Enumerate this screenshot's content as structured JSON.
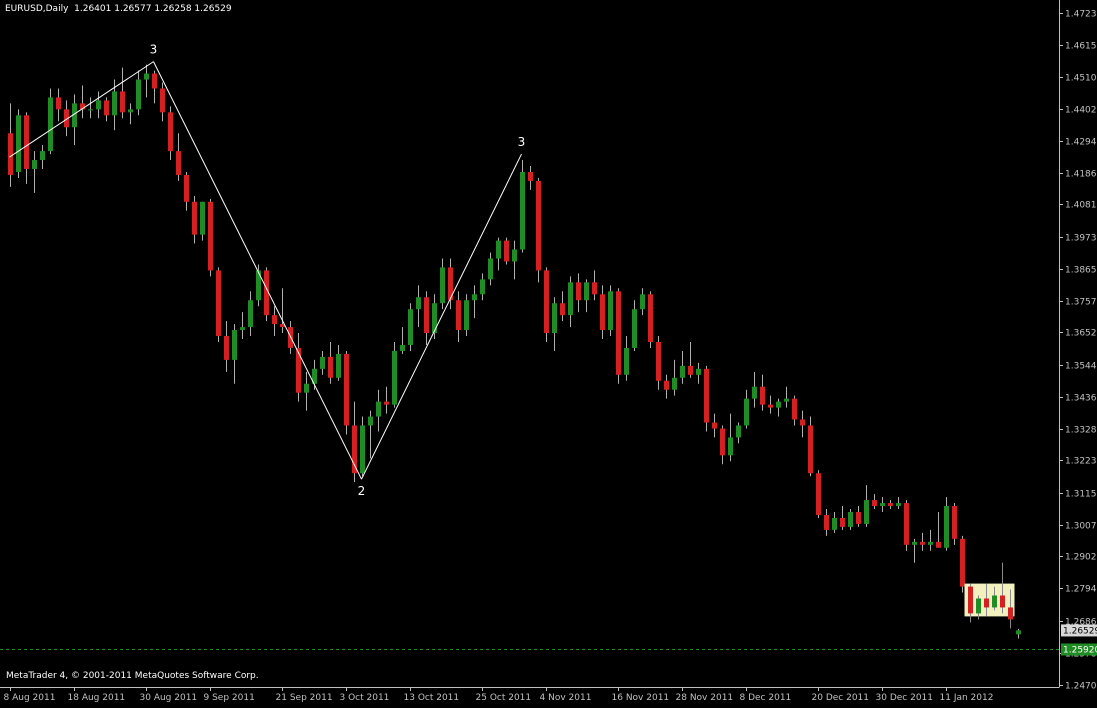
{
  "header": {
    "symbol": "EURUSD,Daily",
    "open": "1.26401",
    "high": "1.26577",
    "low": "1.26258",
    "close": "1.26529"
  },
  "copyright": "MetaTrader 4, © 2001-2011 MetaQuotes Software Corp.",
  "colors": {
    "background": "#000000",
    "axis": "#c0c0c0",
    "bull": "#1f8c24",
    "bear": "#d42020",
    "wick": "#b0b0b0",
    "zigzag": "#ffffff",
    "highlight": "#f3f0c0",
    "ask_line": "#1f8c24",
    "price_label_bg": "#1f8c24",
    "current_price_bg": "#d8d8d8"
  },
  "chart_data": {
    "type": "candlestick",
    "symbol": "EURUSD",
    "timeframe": "Daily",
    "y_ticks": [
      "1.47230",
      "1.46150",
      "1.45100",
      "1.44020",
      "1.42940",
      "1.41860",
      "1.40810",
      "1.39730",
      "1.38650",
      "1.37570",
      "1.36520",
      "1.35440",
      "1.34360",
      "1.33280",
      "1.32230",
      "1.31150",
      "1.30070",
      "1.29020",
      "1.27940",
      "1.26860",
      "1.25780",
      "1.24700"
    ],
    "x_tick_labels": [
      "8 Aug 2011",
      "18 Aug 2011",
      "30 Aug 2011",
      "9 Sep 2011",
      "21 Sep 2011",
      "3 Oct 2011",
      "13 Oct 2011",
      "25 Oct 2011",
      "4 Nov 2011",
      "16 Nov 2011",
      "28 Nov 2011",
      "8 Dec 2011",
      "20 Dec 2011",
      "30 Dec 2011",
      "11 Jan 2012"
    ],
    "x_tick_index": [
      0,
      8,
      17,
      25,
      34,
      42,
      50,
      59,
      67,
      76,
      84,
      92,
      101,
      109,
      117
    ],
    "ylim": [
      1.247,
      1.4723
    ],
    "current_price": "1.26529",
    "ask_price": "1.25920",
    "ask_level": 1.2592,
    "candles": [
      [
        1.432,
        1.442,
        1.414,
        1.418
      ],
      [
        1.419,
        1.44,
        1.417,
        1.438
      ],
      [
        1.438,
        1.439,
        1.415,
        1.42
      ],
      [
        1.42,
        1.426,
        1.412,
        1.423
      ],
      [
        1.423,
        1.428,
        1.42,
        1.426
      ],
      [
        1.426,
        1.447,
        1.425,
        1.444
      ],
      [
        1.444,
        1.447,
        1.436,
        1.44
      ],
      [
        1.44,
        1.443,
        1.431,
        1.434
      ],
      [
        1.434,
        1.445,
        1.428,
        1.442
      ],
      [
        1.442,
        1.448,
        1.437,
        1.44
      ],
      [
        1.44,
        1.444,
        1.437,
        1.44
      ],
      [
        1.44,
        1.446,
        1.437,
        1.443
      ],
      [
        1.443,
        1.444,
        1.436,
        1.438
      ],
      [
        1.438,
        1.45,
        1.433,
        1.446
      ],
      [
        1.446,
        1.454,
        1.437,
        1.439
      ],
      [
        1.439,
        1.442,
        1.435,
        1.44
      ],
      [
        1.44,
        1.453,
        1.438,
        1.45
      ],
      [
        1.45,
        1.455,
        1.444,
        1.452
      ],
      [
        1.452,
        1.453,
        1.442,
        1.447
      ],
      [
        1.447,
        1.449,
        1.436,
        1.439
      ],
      [
        1.439,
        1.441,
        1.423,
        1.426
      ],
      [
        1.426,
        1.432,
        1.416,
        1.418
      ],
      [
        1.418,
        1.419,
        1.406,
        1.409
      ],
      [
        1.409,
        1.411,
        1.395,
        1.398
      ],
      [
        1.398,
        1.409,
        1.396,
        1.409
      ],
      [
        1.409,
        1.41,
        1.384,
        1.386
      ],
      [
        1.386,
        1.387,
        1.362,
        1.364
      ],
      [
        1.364,
        1.369,
        1.352,
        1.356
      ],
      [
        1.356,
        1.368,
        1.348,
        1.366
      ],
      [
        1.366,
        1.372,
        1.363,
        1.367
      ],
      [
        1.367,
        1.379,
        1.364,
        1.376
      ],
      [
        1.376,
        1.388,
        1.374,
        1.386
      ],
      [
        1.386,
        1.387,
        1.369,
        1.371
      ],
      [
        1.371,
        1.374,
        1.364,
        1.368
      ],
      [
        1.368,
        1.38,
        1.365,
        1.367
      ],
      [
        1.367,
        1.369,
        1.358,
        1.36
      ],
      [
        1.36,
        1.365,
        1.342,
        1.345
      ],
      [
        1.345,
        1.352,
        1.339,
        1.348
      ],
      [
        1.348,
        1.356,
        1.346,
        1.353
      ],
      [
        1.353,
        1.359,
        1.351,
        1.357
      ],
      [
        1.357,
        1.362,
        1.348,
        1.35
      ],
      [
        1.35,
        1.361,
        1.349,
        1.358
      ],
      [
        1.358,
        1.359,
        1.331,
        1.334
      ],
      [
        1.334,
        1.342,
        1.315,
        1.318
      ],
      [
        1.318,
        1.337,
        1.317,
        1.334
      ],
      [
        1.334,
        1.339,
        1.323,
        1.337
      ],
      [
        1.337,
        1.346,
        1.332,
        1.342
      ],
      [
        1.342,
        1.347,
        1.338,
        1.341
      ],
      [
        1.341,
        1.362,
        1.34,
        1.359
      ],
      [
        1.359,
        1.367,
        1.358,
        1.361
      ],
      [
        1.361,
        1.375,
        1.359,
        1.373
      ],
      [
        1.373,
        1.381,
        1.367,
        1.377
      ],
      [
        1.377,
        1.379,
        1.361,
        1.365
      ],
      [
        1.365,
        1.378,
        1.363,
        1.375
      ],
      [
        1.375,
        1.39,
        1.373,
        1.387
      ],
      [
        1.387,
        1.39,
        1.373,
        1.376
      ],
      [
        1.376,
        1.379,
        1.362,
        1.366
      ],
      [
        1.366,
        1.378,
        1.364,
        1.376
      ],
      [
        1.376,
        1.381,
        1.37,
        1.378
      ],
      [
        1.378,
        1.385,
        1.376,
        1.383
      ],
      [
        1.383,
        1.392,
        1.381,
        1.39
      ],
      [
        1.39,
        1.397,
        1.386,
        1.396
      ],
      [
        1.396,
        1.397,
        1.388,
        1.389
      ],
      [
        1.389,
        1.396,
        1.383,
        1.393
      ],
      [
        1.393,
        1.423,
        1.392,
        1.419
      ],
      [
        1.419,
        1.421,
        1.413,
        1.416
      ],
      [
        1.416,
        1.417,
        1.382,
        1.386
      ],
      [
        1.386,
        1.387,
        1.362,
        1.365
      ],
      [
        1.365,
        1.377,
        1.359,
        1.375
      ],
      [
        1.375,
        1.379,
        1.369,
        1.371
      ],
      [
        1.371,
        1.384,
        1.367,
        1.382
      ],
      [
        1.382,
        1.385,
        1.372,
        1.376
      ],
      [
        1.376,
        1.383,
        1.372,
        1.382
      ],
      [
        1.382,
        1.386,
        1.376,
        1.378
      ],
      [
        1.378,
        1.381,
        1.363,
        1.366
      ],
      [
        1.366,
        1.381,
        1.364,
        1.379
      ],
      [
        1.379,
        1.38,
        1.348,
        1.351
      ],
      [
        1.351,
        1.364,
        1.349,
        1.36
      ],
      [
        1.36,
        1.376,
        1.359,
        1.373
      ],
      [
        1.373,
        1.38,
        1.371,
        1.378
      ],
      [
        1.378,
        1.379,
        1.36,
        1.362
      ],
      [
        1.362,
        1.364,
        1.346,
        1.349
      ],
      [
        1.349,
        1.351,
        1.343,
        1.346
      ],
      [
        1.346,
        1.356,
        1.344,
        1.35
      ],
      [
        1.35,
        1.359,
        1.348,
        1.354
      ],
      [
        1.354,
        1.362,
        1.35,
        1.351
      ],
      [
        1.351,
        1.355,
        1.348,
        1.353
      ],
      [
        1.353,
        1.354,
        1.332,
        1.335
      ],
      [
        1.335,
        1.338,
        1.33,
        1.333
      ],
      [
        1.333,
        1.334,
        1.321,
        1.324
      ],
      [
        1.324,
        1.338,
        1.322,
        1.33
      ],
      [
        1.33,
        1.335,
        1.328,
        1.334
      ],
      [
        1.334,
        1.346,
        1.333,
        1.343
      ],
      [
        1.343,
        1.352,
        1.34,
        1.347
      ],
      [
        1.347,
        1.351,
        1.339,
        1.341
      ],
      [
        1.341,
        1.344,
        1.338,
        1.34
      ],
      [
        1.34,
        1.343,
        1.337,
        1.342
      ],
      [
        1.342,
        1.347,
        1.34,
        1.343
      ],
      [
        1.343,
        1.344,
        1.334,
        1.336
      ],
      [
        1.336,
        1.339,
        1.33,
        1.334
      ],
      [
        1.334,
        1.337,
        1.317,
        1.318
      ],
      [
        1.318,
        1.319,
        1.303,
        1.304
      ],
      [
        1.304,
        1.306,
        1.297,
        1.299
      ],
      [
        1.299,
        1.305,
        1.298,
        1.303
      ],
      [
        1.303,
        1.307,
        1.299,
        1.3
      ],
      [
        1.3,
        1.306,
        1.299,
        1.305
      ],
      [
        1.305,
        1.307,
        1.3,
        1.301
      ],
      [
        1.301,
        1.314,
        1.3,
        1.309
      ],
      [
        1.309,
        1.311,
        1.306,
        1.307
      ],
      [
        1.307,
        1.31,
        1.305,
        1.308
      ],
      [
        1.308,
        1.309,
        1.306,
        1.307
      ],
      [
        1.307,
        1.31,
        1.306,
        1.308
      ],
      [
        1.308,
        1.309,
        1.292,
        1.294
      ],
      [
        1.294,
        1.296,
        1.288,
        1.295
      ],
      [
        1.295,
        1.298,
        1.292,
        1.294
      ],
      [
        1.294,
        1.299,
        1.292,
        1.295
      ],
      [
        1.295,
        1.305,
        1.293,
        1.293
      ],
      [
        1.293,
        1.31,
        1.292,
        1.307
      ],
      [
        1.307,
        1.308,
        1.294,
        1.296
      ],
      [
        1.296,
        1.297,
        1.278,
        1.28
      ],
      [
        1.28,
        1.281,
        1.268,
        1.271
      ],
      [
        1.271,
        1.277,
        1.269,
        1.276
      ],
      [
        1.276,
        1.281,
        1.27,
        1.273
      ],
      [
        1.273,
        1.28,
        1.272,
        1.277
      ],
      [
        1.277,
        1.288,
        1.271,
        1.273
      ],
      [
        1.273,
        1.279,
        1.266,
        1.269
      ],
      [
        1.264,
        1.2658,
        1.2626,
        1.2653
      ]
    ],
    "zigzag_points": [
      {
        "index": 0,
        "price": 1.424,
        "label": ""
      },
      {
        "index": 18,
        "price": 1.456,
        "label": "3"
      },
      {
        "index": 44,
        "price": 1.316,
        "label": "2"
      },
      {
        "index": 64,
        "price": 1.425,
        "label": "3"
      }
    ],
    "highlight_range": {
      "from_index": 120,
      "to_index": 125,
      "price_low": 1.27,
      "price_high": 1.281
    }
  }
}
